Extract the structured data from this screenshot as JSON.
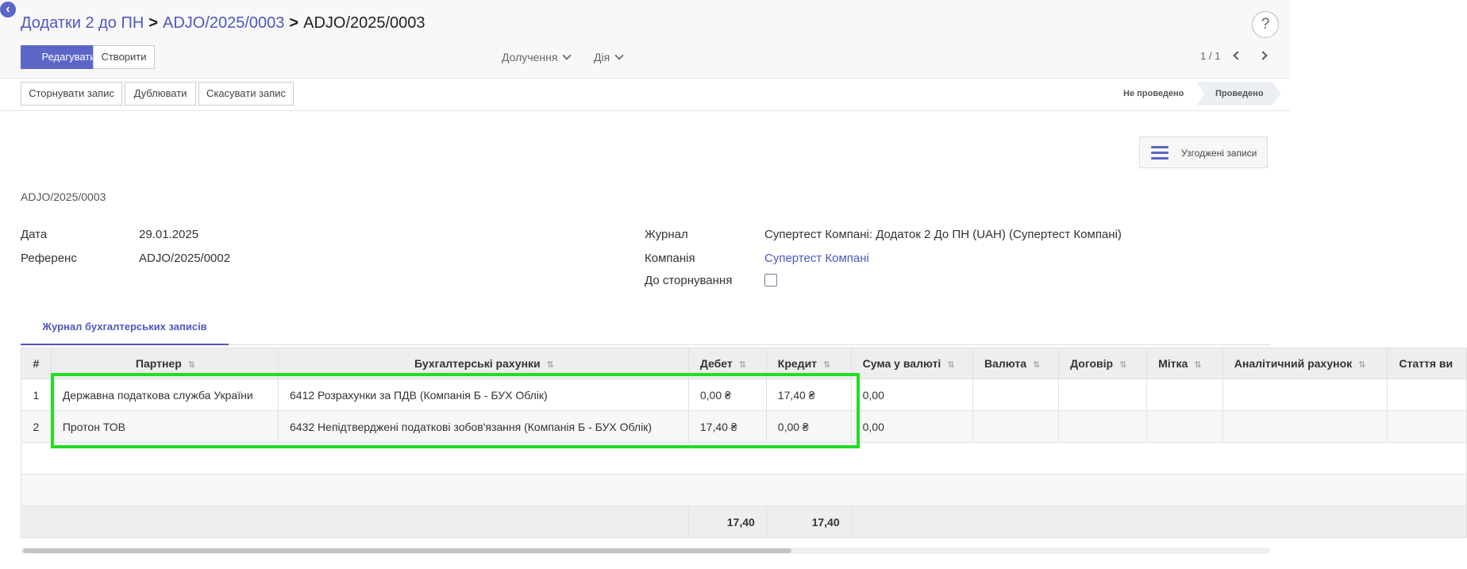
{
  "header": {
    "breadcrumbs": [
      "Додатки 2 до ПН",
      "ADJO/2025/0003"
    ],
    "current": "ADJO/2025/0003",
    "separator": ">",
    "help_label": "?",
    "back_label": "‹"
  },
  "toolbar": {
    "edit_label": "Редагувати",
    "create_label": "Створити",
    "receive_label": "Долучення",
    "action_label": "Дія",
    "pager": "1 / 1"
  },
  "status_bar": {
    "buttons": [
      "Сторнувати запис",
      "Дублювати",
      "Скасувати запис"
    ],
    "states": [
      "Не проведено",
      "Проведено"
    ],
    "active_state": "Проведено"
  },
  "smart_button": {
    "label": "Узгоджені записи",
    "icon": "list-icon"
  },
  "form": {
    "name": "ADJO/2025/0003",
    "date_label": "Дата",
    "date_value": "29.01.2025",
    "ref_label": "Референс",
    "ref_value": "ADJO/2025/0002",
    "journal_label": "Журнал",
    "journal_value": "Супертест Компані: Додаток 2 До ПН (UAH) (Супертест Компані)",
    "company_label": "Компанія",
    "company_value": "Супертест Компані",
    "reverse_label": "До сторнування",
    "reverse_checked": false
  },
  "tabs": {
    "active": "Журнал бухгалтерських записів"
  },
  "table": {
    "columns": {
      "num": "#",
      "partner": "Партнер",
      "account": "Бухгалтерські рахунки",
      "debit": "Дебет",
      "credit": "Кредит",
      "amount_currency": "Сума у валюті",
      "currency": "Валюта",
      "contract": "Договір",
      "tag": "Мітка",
      "analytic": "Аналітичний рахунок",
      "item": "Стаття ви"
    },
    "rows": [
      {
        "num": "1",
        "partner": "Державна податкова служба України",
        "account": "6412 Розрахунки за ПДВ (Компанія Б - БУХ Облік)",
        "debit": "0,00 ₴",
        "credit": "17,40 ₴",
        "amount_currency": "0,00"
      },
      {
        "num": "2",
        "partner": "Протон ТОВ",
        "account": "6432 Непідтверджені податкові зобов'язання (Компанія Б - БУХ Облік)",
        "debit": "17,40 ₴",
        "credit": "0,00 ₴",
        "amount_currency": "0,00"
      }
    ],
    "totals": {
      "debit": "17,40",
      "credit": "17,40"
    },
    "sort_icon": "⇅"
  },
  "colors": {
    "accent": "#5b66c6",
    "highlight": "#22dd22"
  }
}
